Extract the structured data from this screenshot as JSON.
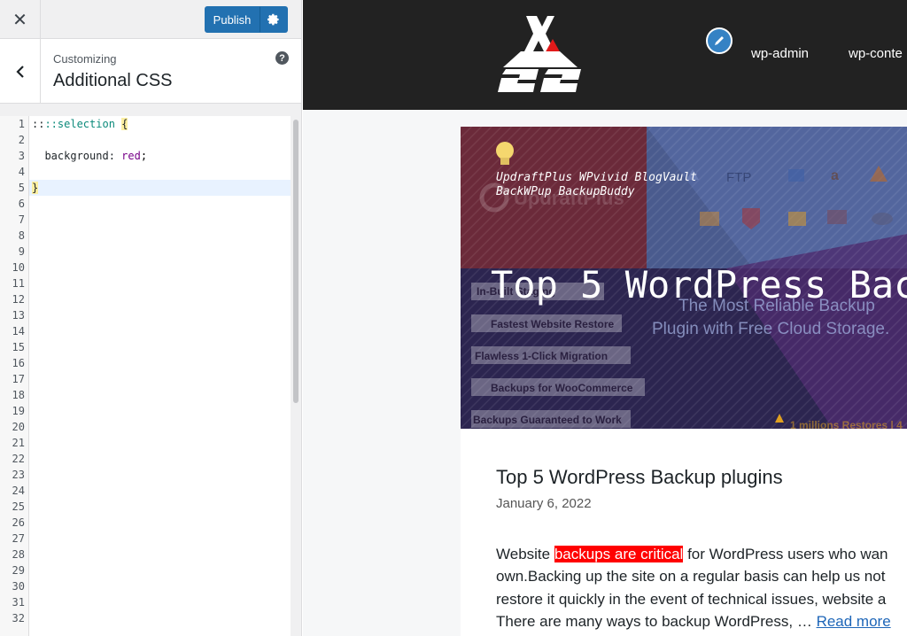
{
  "sidebar": {
    "close_icon": "close-icon",
    "publish_label": "Publish",
    "settings_icon": "gear-icon",
    "customizing_label": "Customizing",
    "section_title": "Additional CSS",
    "help_icon": "help-icon",
    "back_icon": "chevron-left-icon"
  },
  "editor": {
    "line_numbers": [
      "1",
      "2",
      "3",
      "4",
      "5",
      "6",
      "7",
      "8",
      "9",
      "10",
      "11",
      "12",
      "13",
      "14",
      "15",
      "16",
      "17",
      "18",
      "19",
      "20",
      "21",
      "22",
      "23",
      "24",
      "25",
      "26",
      "27",
      "28",
      "29",
      "30",
      "31",
      "32"
    ],
    "line1_selector": "::selection",
    "line1_brace": "{",
    "line3_property": "background:",
    "line3_value": "red",
    "line3_semicolon": ";",
    "line5_brace": "}",
    "active_line": 5
  },
  "preview": {
    "nav_items": [
      "wp-admin",
      "wp-conte"
    ],
    "edit_icon": "pencil-icon",
    "featured": {
      "plugins_line1": "UpdraftPlus WPvivid BlogVault",
      "plugins_line2": "BackWPup BackupBuddy",
      "headline": "Top 5 WordPress Bac",
      "watermark": "UpdraftPlus",
      "tagline1": "The Most Reliable Backup",
      "tagline2": "Plugin with Free Cloud Storage.",
      "features": [
        "In-Built Staging",
        "Fastest Website Restore",
        "Flawless 1-Click Migration",
        "Backups for WooCommerce",
        "Backups Guaranteed to Work"
      ],
      "footer_note": "1 millions Restores | 4",
      "icons_top": [
        "FTP"
      ]
    },
    "post": {
      "title": "Top 5 WordPress Backup plugins",
      "date": "January 6, 2022",
      "excerpt_line1_pre": "Website ",
      "excerpt_line1_hl": "backups are critical",
      "excerpt_line1_post": " for WordPress users who wan",
      "excerpt_line2": "own.Backing up the site on a regular basis can help us not",
      "excerpt_line3": "restore it quickly in the event of technical issues, website a",
      "excerpt_line4_pre": "There are many ways to backup WordPress, … ",
      "read_more": "Read more"
    },
    "colors": {
      "header_bg": "#222222",
      "accent": "#2271b1",
      "highlight": "#ff0000"
    }
  }
}
